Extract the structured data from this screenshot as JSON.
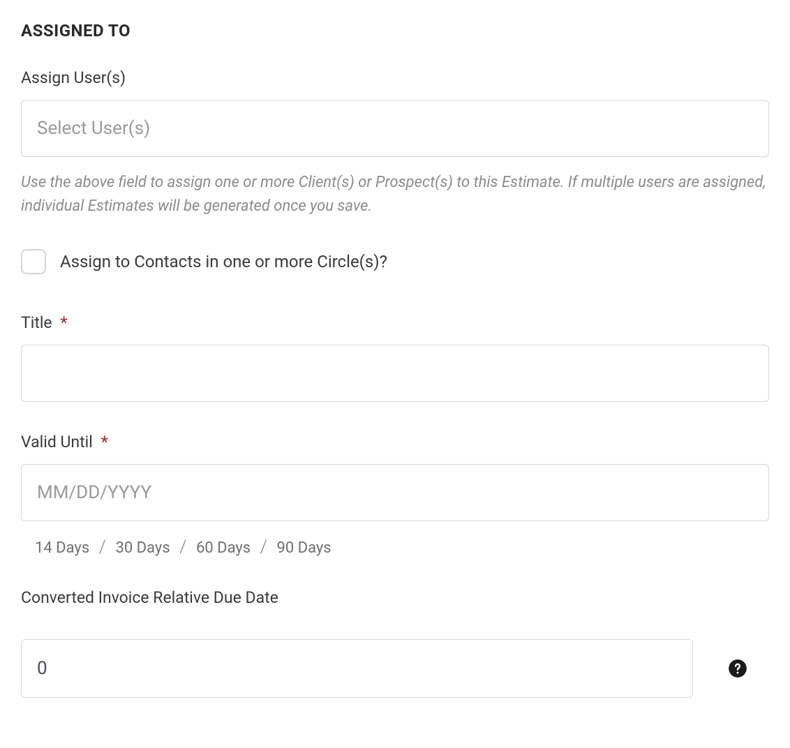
{
  "section": {
    "heading": "ASSIGNED TO"
  },
  "assign_users": {
    "label": "Assign User(s)",
    "placeholder": "Select User(s)",
    "help": "Use the above field to assign one or more Client(s) or Prospect(s) to this Estimate. If multiple users are assigned, individual Estimates will be generated once you save."
  },
  "assign_circles": {
    "label": "Assign to Contacts in one or more Circle(s)?"
  },
  "title_field": {
    "label": "Title",
    "required": "*",
    "value": ""
  },
  "valid_until": {
    "label": "Valid Until",
    "required": "*",
    "placeholder": "MM/DD/YYYY",
    "value": "",
    "presets": [
      "14 Days",
      "30 Days",
      "60 Days",
      "90 Days"
    ]
  },
  "converted_due": {
    "label": "Converted Invoice Relative Due Date",
    "value": "0"
  }
}
